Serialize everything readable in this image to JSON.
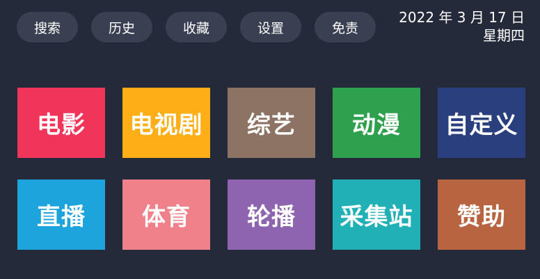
{
  "nav": {
    "items": [
      {
        "label": "搜索",
        "name": "nav-search-button"
      },
      {
        "label": "历史",
        "name": "nav-history-button"
      },
      {
        "label": "收藏",
        "name": "nav-favorites-button"
      },
      {
        "label": "设置",
        "name": "nav-settings-button"
      },
      {
        "label": "免责",
        "name": "nav-disclaimer-button"
      }
    ]
  },
  "date": {
    "line1": "2022 年 3 月 17 日",
    "line2": "星期四"
  },
  "tiles": [
    {
      "label": "电影",
      "color": "#f1345a",
      "name": "tile-movies"
    },
    {
      "label": "电视剧",
      "color": "#feae17",
      "name": "tile-tv-series"
    },
    {
      "label": "综艺",
      "color": "#8c7363",
      "name": "tile-variety"
    },
    {
      "label": "动漫",
      "color": "#2fa04d",
      "name": "tile-anime"
    },
    {
      "label": "自定义",
      "color": "#2a3f7d",
      "name": "tile-custom"
    },
    {
      "label": "直播",
      "color": "#1ea4dc",
      "name": "tile-live"
    },
    {
      "label": "体育",
      "color": "#f0808a",
      "name": "tile-sports"
    },
    {
      "label": "轮播",
      "color": "#8e63b0",
      "name": "tile-carousel"
    },
    {
      "label": "采集站",
      "color": "#20b0b6",
      "name": "tile-collection-site"
    },
    {
      "label": "赞助",
      "color": "#b96441",
      "name": "tile-sponsor"
    }
  ]
}
